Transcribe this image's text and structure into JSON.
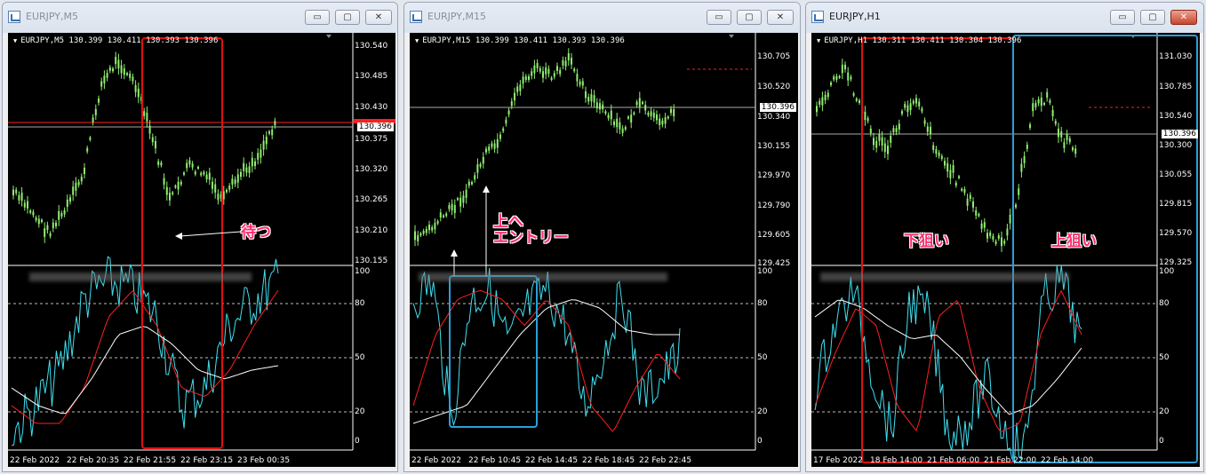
{
  "windows": [
    {
      "title": "EURJPY,M5",
      "header": "EURJPY,M5  130.399 130.411 130.393 130.396",
      "price_labels": [
        "130.540",
        "130.485",
        "130.430",
        "130.375",
        "130.320",
        "130.265",
        "130.210",
        "130.155"
      ],
      "price_tag": "130.396",
      "ind_labels": [
        "100",
        "80",
        "50",
        "20",
        "0"
      ],
      "time_labels": [
        "22 Feb 2022",
        "22 Feb 20:35",
        "22 Feb 21:55",
        "22 Feb 23:15",
        "23 Feb 00:35"
      ],
      "annotation": "待つ"
    },
    {
      "title": "EURJPY,M15",
      "header": "EURJPY,M15  130.399 130.411 130.393 130.396",
      "price_labels": [
        "130.705",
        "130.520",
        "130.340",
        "130.155",
        "129.970",
        "129.790",
        "129.605",
        "129.425"
      ],
      "price_tag": "130.396",
      "ind_labels": [
        "100",
        "80",
        "50",
        "20",
        "0"
      ],
      "time_labels": [
        "22 Feb 2022",
        "22 Feb 10:45",
        "22 Feb 14:45",
        "22 Feb 18:45",
        "22 Feb 22:45"
      ],
      "annotation_line1": "上へ",
      "annotation_line2": "エントリー"
    },
    {
      "title": "EURJPY,H1",
      "header": "EURJPY,H1  130.311 130.411 130.304 130.396",
      "price_labels": [
        "131.030",
        "130.785",
        "130.540",
        "130.300",
        "130.055",
        "129.815",
        "129.570",
        "129.325"
      ],
      "price_tag": "130.396",
      "ind_labels": [
        "100",
        "80",
        "50",
        "20",
        "0"
      ],
      "time_labels": [
        "17 Feb 2022",
        "18 Feb 14:00",
        "21 Feb 06:00",
        "21 Feb 22:00",
        "22 Feb 14:00"
      ],
      "annotation_left": "下狙い",
      "annotation_right": "上狙い"
    }
  ],
  "buttons": {
    "minimize": "▭",
    "maximize": "▢",
    "close": "✕"
  },
  "colors": {
    "candle": "#90ee70",
    "signal_red": "#ff1e1e",
    "stoch_cyan": "#3fe0f0",
    "box_red": "#e01010",
    "box_blue": "#29a0d8",
    "annotation": "#ff2d6e"
  }
}
